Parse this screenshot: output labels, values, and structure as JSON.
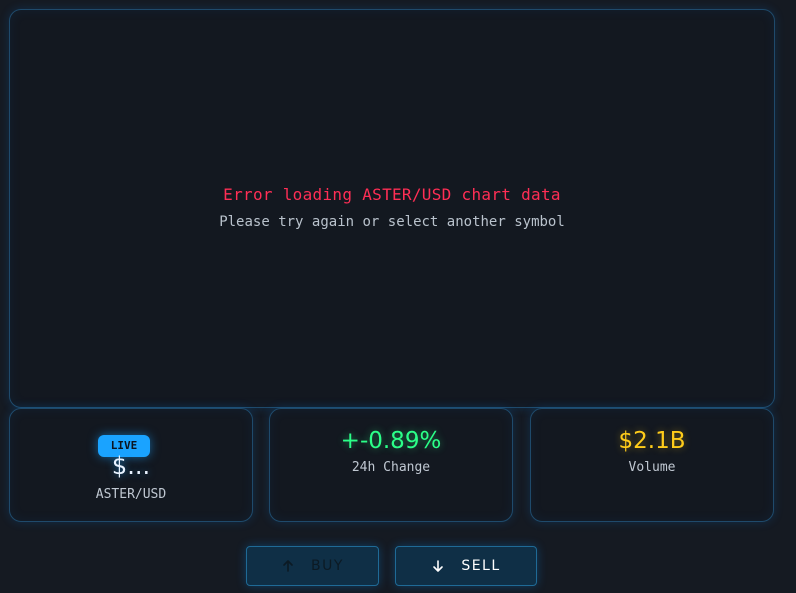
{
  "chart": {
    "error_title": "Error loading ASTER/USD chart data",
    "error_subtitle": "Please try again or select another symbol"
  },
  "stats": {
    "price": {
      "badge": "LIVE",
      "value": "$...",
      "label": "ASTER/USD"
    },
    "change": {
      "value": "+-0.89%",
      "label": "24h Change",
      "color": "#2bff88"
    },
    "volume": {
      "value": "$2.1B",
      "label": "Volume",
      "color": "#ffcc1a"
    }
  },
  "actions": {
    "buy": {
      "label": "BUY",
      "icon": "arrow-up-icon"
    },
    "sell": {
      "label": "SELL",
      "icon": "arrow-down-icon"
    }
  },
  "colors": {
    "background": "#151a22",
    "panel_border": "#1f4a6b",
    "accent": "#1aa3ff",
    "error": "#ff2e55"
  }
}
